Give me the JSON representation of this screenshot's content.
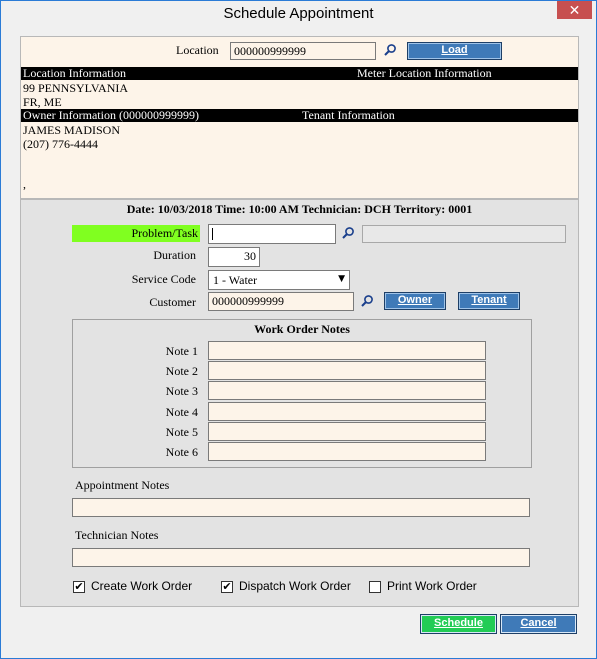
{
  "window": {
    "title": "Schedule Appointment",
    "close_glyph": "✕"
  },
  "location": {
    "label": "Location",
    "value": "000000999999",
    "load_label": "Load"
  },
  "location_info": {
    "header_left": "Location Information",
    "header_right": "Meter Location Information",
    "line1": "99 PENNSYLVANIA",
    "line2": "FR, ME"
  },
  "owner_info": {
    "header_left": "Owner Information (000000999999)",
    "header_right": "Tenant Information",
    "name": "JAMES MADISON",
    "phone": "(207) 776-4444",
    "extra": ","
  },
  "appointment": {
    "summary": "Date: 10/03/2018   Time: 10:00 AM   Technician: DCH   Territory: 0001"
  },
  "form": {
    "problem_label": "Problem/Task",
    "problem_value": "",
    "problem_desc": "",
    "duration_label": "Duration",
    "duration_value": "30",
    "service_code_label": "Service Code",
    "service_code_value": "1 - Water",
    "customer_label": "Customer",
    "customer_value": "000000999999",
    "owner_btn": "Owner",
    "tenant_btn": "Tenant"
  },
  "work_order_notes": {
    "title": "Work Order Notes",
    "notes": [
      {
        "label": "Note 1",
        "value": ""
      },
      {
        "label": "Note 2",
        "value": ""
      },
      {
        "label": "Note 3",
        "value": ""
      },
      {
        "label": "Note 4",
        "value": ""
      },
      {
        "label": "Note 5",
        "value": ""
      },
      {
        "label": "Note 6",
        "value": ""
      }
    ]
  },
  "appointment_notes": {
    "label": "Appointment Notes",
    "value": ""
  },
  "technician_notes": {
    "label": "Technician Notes",
    "value": ""
  },
  "options": {
    "create_work_order": {
      "label": "Create Work Order",
      "checked": true
    },
    "dispatch_work_order": {
      "label": "Dispatch Work Order",
      "checked": true
    },
    "print_work_order": {
      "label": "Print Work Order",
      "checked": false
    }
  },
  "actions": {
    "schedule": "Schedule",
    "cancel": "Cancel"
  },
  "colors": {
    "accent": "#3f7ab8",
    "problem_highlight": "#80ff20",
    "schedule_button": "#22cc55",
    "panel_bg": "#fdf4e9"
  },
  "icons": {
    "lookup": "magnifier-icon",
    "close": "close-icon",
    "dropdown": "chevron-down-icon",
    "check": "checkmark-icon"
  }
}
